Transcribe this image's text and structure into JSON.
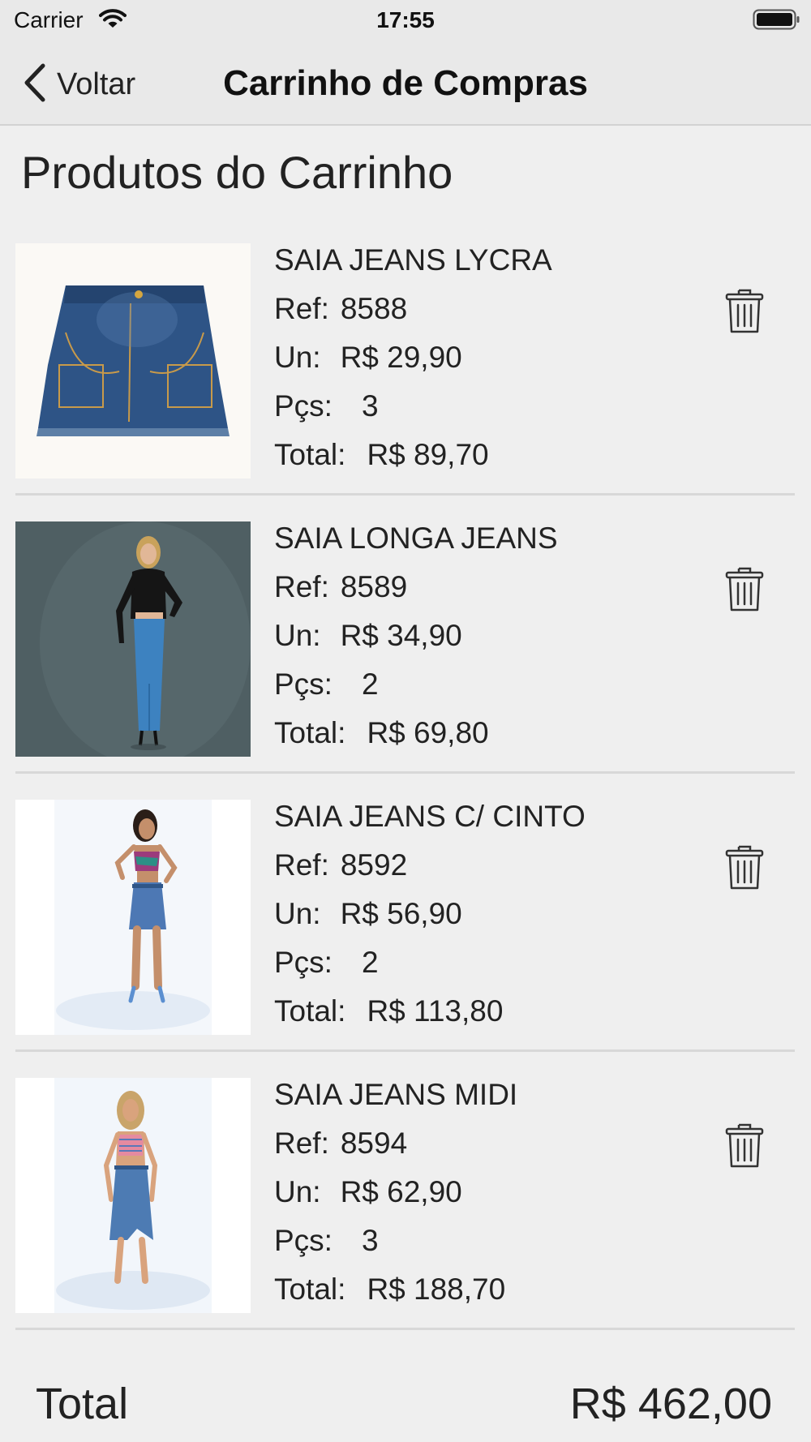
{
  "status_bar": {
    "carrier": "Carrier",
    "time": "17:55"
  },
  "nav": {
    "back_label": "Voltar",
    "title": "Carrinho de Compras"
  },
  "section_title": "Produtos do Carrinho",
  "labels": {
    "ref": "Ref:",
    "unit": "Un:",
    "pieces": "Pçs:",
    "total": "Total:"
  },
  "products": [
    {
      "name": "SAIA JEANS LYCRA",
      "ref": "8588",
      "unit_price": "R$ 29,90",
      "pieces": "3",
      "total": "R$ 89,70",
      "image": "denim-mini-skirt"
    },
    {
      "name": "SAIA LONGA JEANS",
      "ref": "8589",
      "unit_price": "R$ 34,90",
      "pieces": "2",
      "total": "R$ 69,80",
      "image": "model-long-denim-skirt"
    },
    {
      "name": "SAIA JEANS C/ CINTO",
      "ref": "8592",
      "unit_price": "R$ 56,90",
      "pieces": "2",
      "total": "R$ 113,80",
      "image": "model-denim-skirt-belt"
    },
    {
      "name": "SAIA JEANS MIDI",
      "ref": "8594",
      "unit_price": "R$ 62,90",
      "pieces": "3",
      "total": "R$ 188,70",
      "image": "model-midi-denim-skirt"
    }
  ],
  "cart_total": {
    "label": "Total",
    "value": "R$ 462,00"
  },
  "colors": {
    "background": "#efefef",
    "bar": "#e9e9e9",
    "denim": "#2e5486",
    "text": "#222222"
  }
}
